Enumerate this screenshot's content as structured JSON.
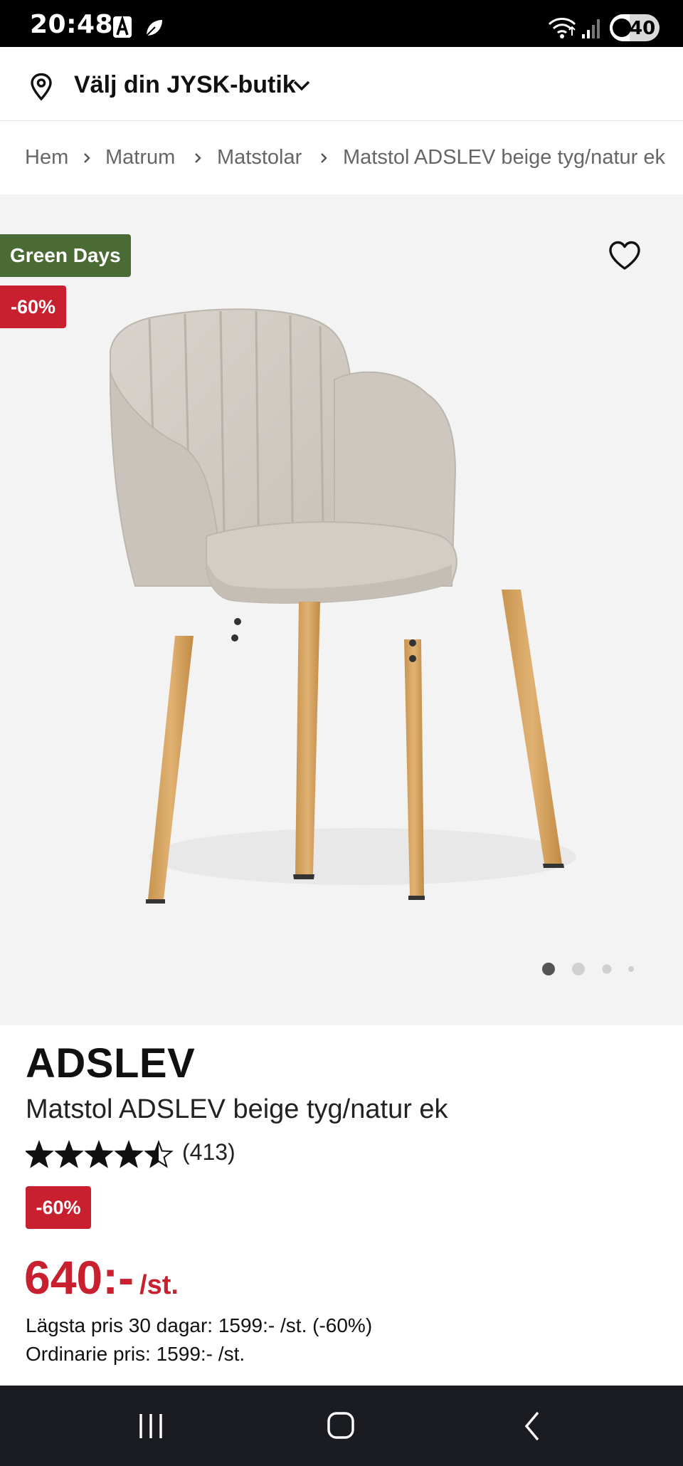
{
  "status_bar": {
    "time": "20:48",
    "battery_level": "40",
    "battery_fraction": 0.4,
    "icons": [
      "notification-a-icon",
      "notification-b-icon",
      "wifi-icon",
      "signal-icon",
      "battery-icon"
    ]
  },
  "store_selector": {
    "label": "Välj din JYSK-butik",
    "icon": "location-pin-icon"
  },
  "breadcrumb": {
    "items": [
      "Hem",
      "Matrum",
      "Matstolar",
      "Matstol ADSLEV beige tyg/natur ek"
    ]
  },
  "gallery": {
    "campaign_badge": "Green Days",
    "discount_badge": "-60%",
    "image_count": 4,
    "active_image": 1,
    "colors": {
      "campaign": "#4b6b35",
      "discount": "#c8202f",
      "background": "#f3f3f3"
    }
  },
  "product": {
    "brand": "ADSLEV",
    "name": "Matstol ADSLEV beige tyg/natur ek",
    "rating": 4.5,
    "rating_max": 5,
    "review_count": "(413)",
    "discount_badge": "-60%",
    "price": "640:-",
    "price_unit": "/st.",
    "lowest_price_text": "Lägsta pris 30 dagar: 1599:- /st. (-60%)",
    "ordinary_price_text": "Ordinarie pris: 1599:- /st.",
    "price_color": "#c8202f"
  },
  "nav_bar": {
    "buttons": [
      "recent-apps",
      "home",
      "back"
    ]
  }
}
